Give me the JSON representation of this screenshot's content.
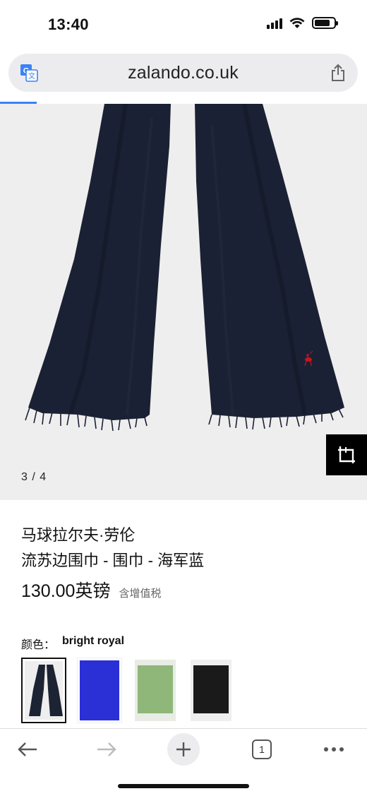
{
  "status": {
    "time": "13:40"
  },
  "browser": {
    "url": "zalando.co.uk",
    "tab_count": "1"
  },
  "product": {
    "image_counter": "3 / 4",
    "brand": "马球拉尔夫·劳伦",
    "name": "流苏边围巾 - 围巾 - 海军蓝",
    "price": "130.00英镑",
    "vat_note": "含增值税",
    "color_label": "颜色：",
    "color_value": "bright royal",
    "swatches": [
      {
        "name": "navy",
        "color": "#1c2333",
        "selected": true
      },
      {
        "name": "bright royal",
        "color": "#2a2fd6",
        "selected": false
      },
      {
        "name": "green",
        "color": "#8fb77a",
        "selected": false
      },
      {
        "name": "black",
        "color": "#1a1a1a",
        "selected": false
      }
    ]
  },
  "colors": {
    "scarf_navy": "#1b2134",
    "logo_red": "#c8141c",
    "image_bg": "#efeeee",
    "accent_blue": "#3b82f6"
  },
  "icons": [
    "translate-icon",
    "share-icon",
    "crop-icon",
    "back-icon",
    "forward-icon",
    "plus-icon",
    "more-icon"
  ]
}
